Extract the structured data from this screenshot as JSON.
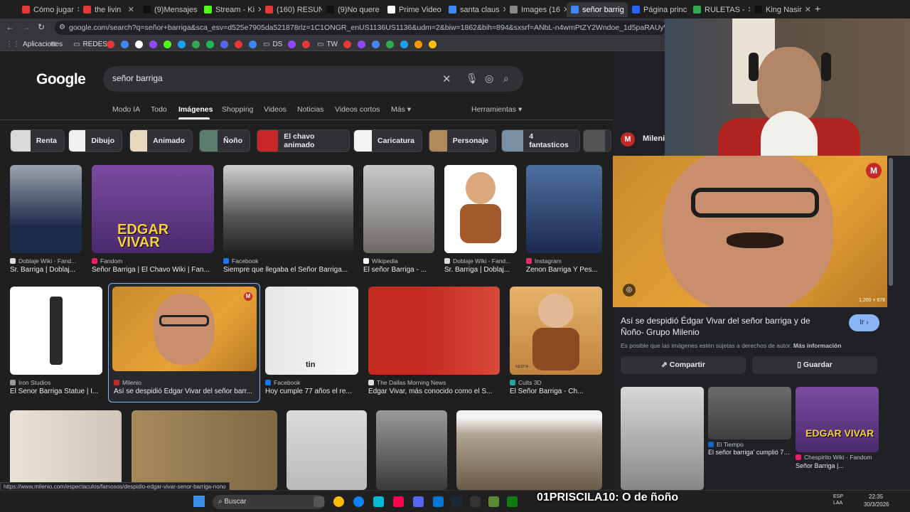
{
  "tabs": [
    {
      "label": "Cómo jugar",
      "color": "#e53935"
    },
    {
      "label": "the livin",
      "color": "#e53935"
    },
    {
      "label": "(9)Mensajes",
      "color": "#111111"
    },
    {
      "label": "Stream - Ki",
      "color": "#53fc18"
    },
    {
      "label": "(160) RESUN",
      "color": "#e53935"
    },
    {
      "label": "(9)No quere",
      "color": "#111111"
    },
    {
      "label": "Prime Video",
      "color": "#ffffff"
    },
    {
      "label": "santa claus",
      "color": "#4285f4"
    },
    {
      "label": "Images (16",
      "color": "#888888"
    },
    {
      "label": "señor barrig",
      "color": "#4285f4"
    },
    {
      "label": "Página princ",
      "color": "#2962ff"
    },
    {
      "label": "RULETAS -",
      "color": "#34a853"
    },
    {
      "label": "King Nasir",
      "color": "#111111"
    }
  ],
  "address_url": "google.com/search?q=señor+barriga&sca_esv=d525e7905da521878rlz=1C1ONGR_enUS1136US1136&udm=2&biw=1862&bih=894&sxsrf=ANbL-n4wmPtZY2Wndoe_1d5paRAUyW6yQ%3A1774935281926&ei=8vZI...",
  "bookmarks": [
    "Aplicaciones",
    "REDES",
    "DS",
    "TW"
  ],
  "search": {
    "logo": "Google",
    "query": "señor barriga"
  },
  "nav_tabs": [
    "Modo IA",
    "Todo",
    "Imágenes",
    "Shopping",
    "Videos",
    "Noticias",
    "Videos cortos",
    "Más ▾"
  ],
  "tools_label": "Herramientas ▾",
  "chips": [
    "Renta",
    "Dibujo",
    "Animado",
    "Ñoño",
    "El chavo animado",
    "Caricatura",
    "Personaje",
    "4 fantasticos"
  ],
  "results_row1": [
    {
      "source": "Doblaje Wiki - Fand...",
      "title": "Sr. Barriga | Doblaj..."
    },
    {
      "source": "Fandom",
      "title": "Señor Barriga | El Chavo Wiki | Fan..."
    },
    {
      "source": "Facebook",
      "title": "Siempre que llegaba el Señor Barriga..."
    },
    {
      "source": "Wikipedia",
      "title": "El señor Barriga - ..."
    },
    {
      "source": "Doblaje Wiki - Fand...",
      "title": "Sr. Barriga | Doblaj..."
    },
    {
      "source": "Instagram",
      "title": "Zenon Barriga Y Pes..."
    }
  ],
  "results_row2": [
    {
      "source": "Iron Studios",
      "title": "El Senor Barriga Statue | I..."
    },
    {
      "source": "Milenio",
      "title": "Así se despidió Édgar Vivar del señor barr..."
    },
    {
      "source": "Facebook",
      "title": "Hoy cumple 77 años el re..."
    },
    {
      "source": "The Dallas Morning News",
      "title": "Édgar Vivar, más conocido como el S..."
    },
    {
      "source": "Cults 3D",
      "title": "El Señor Barriga - Ch..."
    }
  ],
  "image_texts": {
    "edgar_vivar": "EDGAR VIVAR",
    "tin": "tin",
    "nestia": "NESTIA"
  },
  "panel": {
    "source": "Milenio",
    "source_badge": "M",
    "size": "1,200 × 678",
    "title": "Así se despidió Édgar Vivar del señor barriga y de Ñoño- Grupo Milenio",
    "go_label": "Ir ›",
    "note": "Es posible que las imágenes estén sujetas a derechos de autor.",
    "note_link": "Más información",
    "share_label": "Compartir",
    "save_label": "Guardar",
    "related": [
      {
        "source": "El Tiempo",
        "title": "El señor barriga' cumplió 74..."
      },
      {
        "source": "Chespirito Wiki - Fandom",
        "title": "Señor Barriga |..."
      }
    ]
  },
  "status_url": "https://www.milenio.com/espectaculos/famosos/despidio-edgar-vivar-senor-barriga-nono",
  "taskbar": {
    "search_label": "Buscar",
    "overlay": "01PRISCILA10: O de ñoño",
    "lang": "ESP\nLAA",
    "time": "22:35",
    "date": "30/3/2026"
  },
  "colors": {
    "accent": "#8ab4f8",
    "bg": "#1f1f1f",
    "panel": "#202124"
  }
}
